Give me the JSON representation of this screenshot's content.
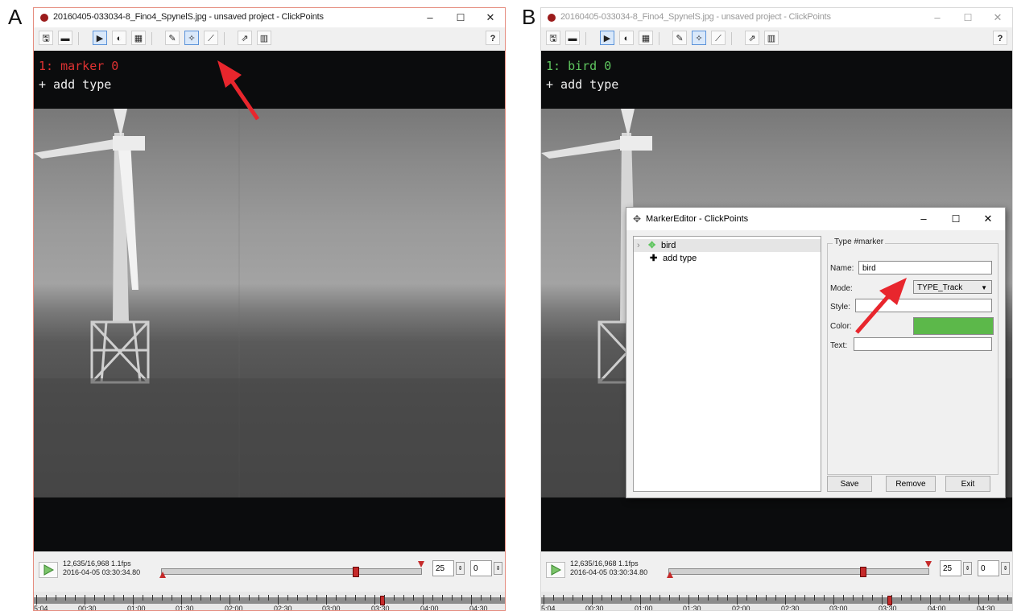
{
  "panels": [
    {
      "letter": "A",
      "window_title": "20160405-033034-8_Fino4_SpynelS.jpg - unsaved project - ClickPoints",
      "marker_text": "1: marker 0",
      "marker_color": "#e03232",
      "add_type_text": "+ add type",
      "frame_info_line1": "12,635/16,968  1.1fps",
      "frame_info_line2": "2016-04-05 03:30:34.80",
      "spin_skip": "25",
      "spin_layer": "0",
      "timeline_labels": [
        "5:04",
        "00:30",
        "01:00",
        "01:30",
        "02:00",
        "02:30",
        "03:00",
        "03:30",
        "04:00",
        "04:30"
      ]
    },
    {
      "letter": "B",
      "window_title": "20160405-033034-8_Fino4_SpynelS.jpg - unsaved project - ClickPoints",
      "marker_text": "1: bird 0",
      "marker_color": "#5fc65f",
      "add_type_text": "+ add type",
      "frame_info_line1": "12,635/16,968  1.1fps",
      "frame_info_line2": "2016-04-05 03:30:34.80",
      "spin_skip": "25",
      "spin_layer": "0",
      "timeline_labels": [
        "5:04",
        "00:30",
        "01:00",
        "01:30",
        "02:00",
        "02:30",
        "03:00",
        "03:30",
        "04:00",
        "04:30"
      ]
    }
  ],
  "toolbar": {
    "help_label": "?",
    "icons": [
      "save-icon",
      "open-folder-icon",
      "play-icon",
      "contrast-icon",
      "film-icon",
      "edit-icon",
      "marker-crosshair-icon",
      "paint-brush-icon",
      "export-icon",
      "chart-icon"
    ]
  },
  "window_controls": {
    "minimize": "–",
    "maximize": "☐",
    "close": "✕"
  },
  "marker_editor": {
    "title": "MarkerEditor - ClickPoints",
    "tree_items": [
      "bird",
      "add type"
    ],
    "group_title": "Type #marker",
    "labels": {
      "name": "Name:",
      "mode": "Mode:",
      "style": "Style:",
      "color": "Color:",
      "text": "Text:"
    },
    "values": {
      "name": "bird",
      "mode": "TYPE_Track",
      "style": "",
      "text": ""
    },
    "color_swatch": "#5cb84a",
    "buttons": {
      "save": "Save",
      "remove": "Remove",
      "exit": "Exit"
    }
  },
  "annotation_arrow_color": "#e8262d"
}
